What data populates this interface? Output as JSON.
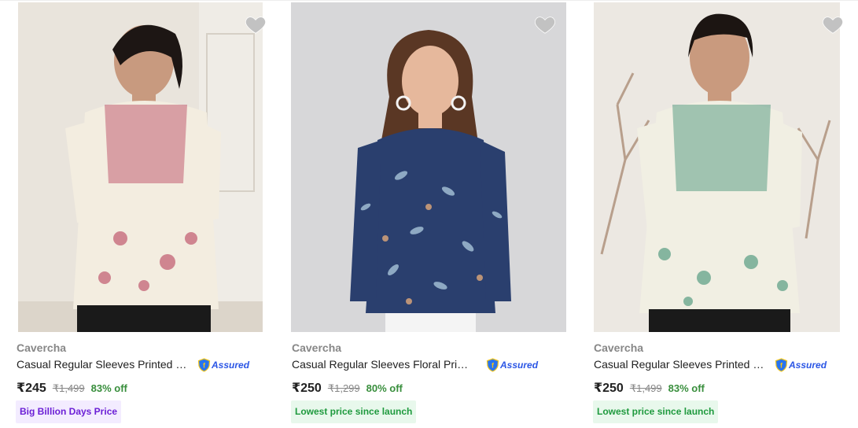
{
  "products": [
    {
      "brand": "Cavercha",
      "title": "Casual Regular Sleeves Printed Women White Top",
      "assured_label": "Assured",
      "price": "₹245",
      "mrp": "₹1,499",
      "discount": "83% off",
      "badge": "Big Billion Days Price",
      "badge_style": "purple",
      "image_bg": "#e9e4dc",
      "top_color": "#f3ede0",
      "print_color": "#b8405a"
    },
    {
      "brand": "Cavercha",
      "title": "Casual Regular Sleeves Floral Print Women Blue Top",
      "assured_label": "Assured",
      "price": "₹250",
      "mrp": "₹1,299",
      "discount": "80% off",
      "badge": "Lowest price since launch",
      "badge_style": "green",
      "image_bg": "#d7d7d9",
      "top_color": "#2a3f6e",
      "print_color": "#a7c4d9"
    },
    {
      "brand": "Cavercha",
      "title": "Casual Regular Sleeves Printed Women White Top",
      "assured_label": "Assured",
      "price": "₹250",
      "mrp": "₹1,499",
      "discount": "83% off",
      "badge": "Lowest price since launch",
      "badge_style": "green",
      "image_bg": "#ece8e2",
      "top_color": "#f1efe3",
      "print_color": "#3f8f72"
    }
  ]
}
